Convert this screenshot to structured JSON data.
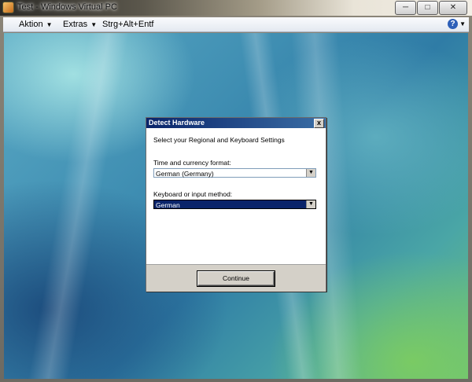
{
  "window": {
    "title": "Test - Windows Virtual PC",
    "minimize_glyph": "─",
    "maximize_glyph": "□",
    "close_glyph": "✕"
  },
  "menubar": {
    "items": [
      {
        "label": "Aktion"
      },
      {
        "label": "Extras"
      },
      {
        "label": "Strg+Alt+Entf"
      }
    ],
    "help_glyph": "?"
  },
  "dialog": {
    "title": "Detect Hardware",
    "close_glyph": "x",
    "heading": "Select your Regional and Keyboard Settings",
    "time_label": "Time and currency format:",
    "time_value": "German (Germany)",
    "keyboard_label": "Keyboard or input method:",
    "keyboard_value": "German",
    "continue_label": "Continue"
  },
  "icons": {
    "app": "virtual-pc-icon",
    "help": "help-icon",
    "dropdown": "chevron-down-icon",
    "cursor": "mouse-pointer-icon"
  },
  "colors": {
    "dialog_title_bar": "#0a246a",
    "selected_field": "#0a246a",
    "dialog_footer": "#d4d0c8"
  }
}
